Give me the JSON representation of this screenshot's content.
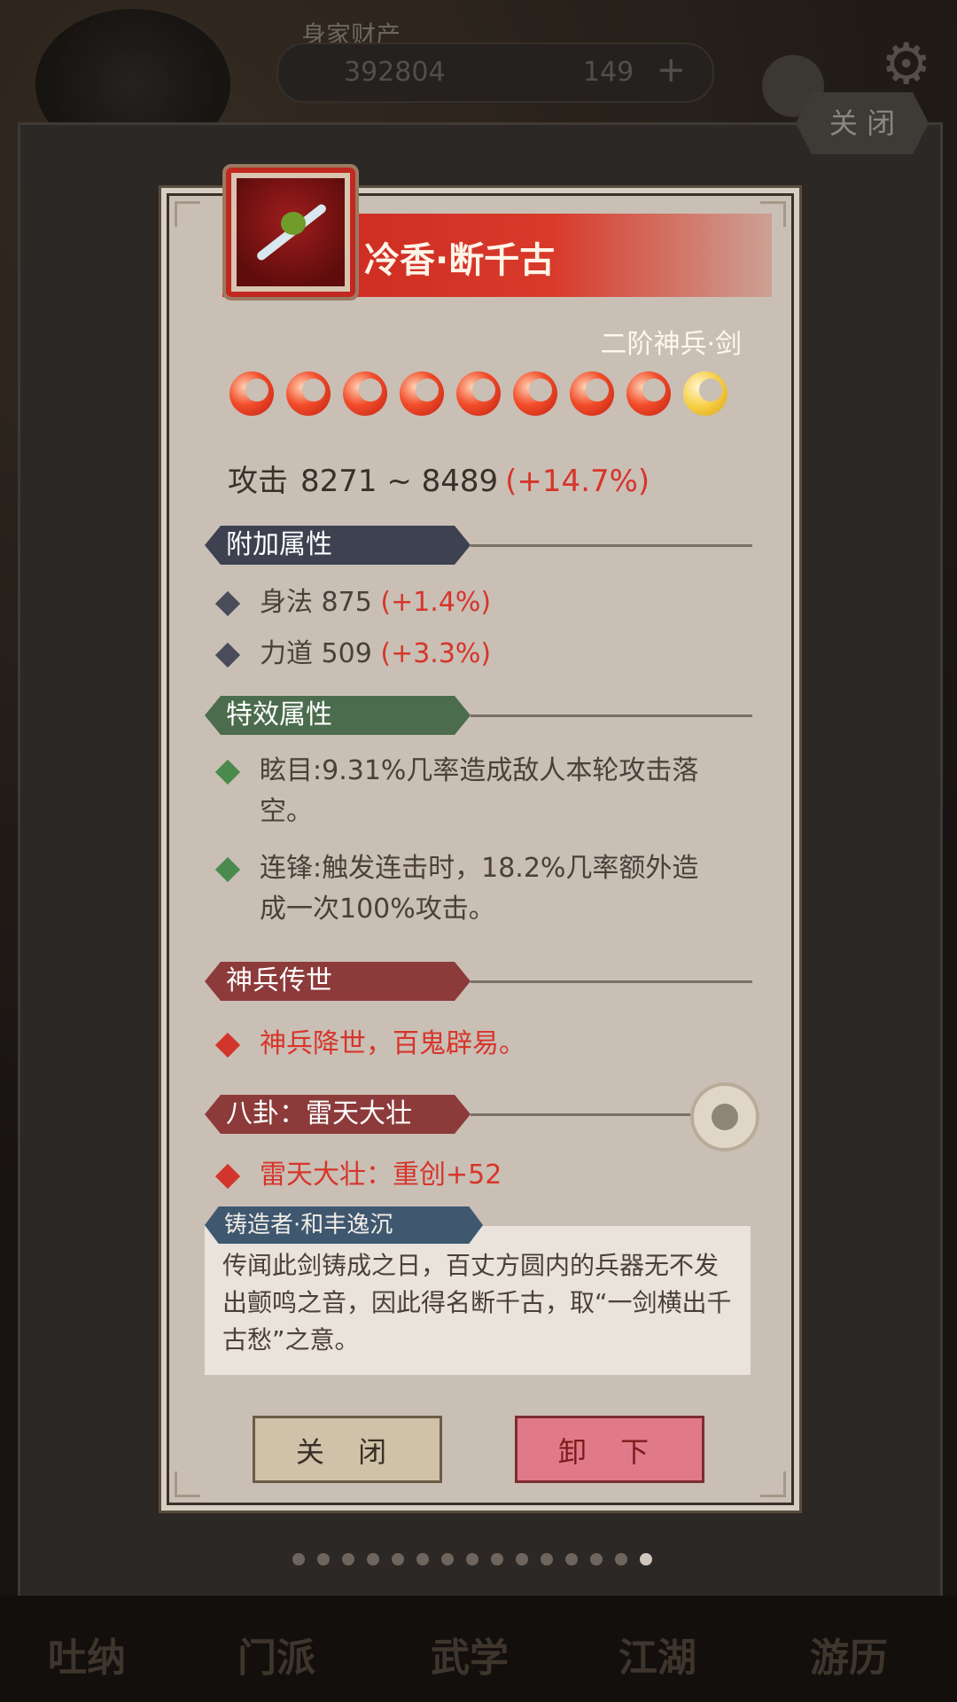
{
  "background": {
    "wealth_label": "身家财产",
    "silver_amount": "392804",
    "jade_amount": "149",
    "plus_symbol": "+",
    "close_top_label": "关 闭",
    "bottom_nav": [
      "吐纳",
      "门派",
      "武学",
      "江湖",
      "游历"
    ]
  },
  "dialog": {
    "title": "冷香·断千古",
    "grade": "二阶神兵·剑",
    "flames": {
      "red_count": 8,
      "gold_count": 1
    },
    "attack": {
      "label": "攻击",
      "range": "8271 ~ 8489",
      "bonus": "(+14.7%)"
    },
    "sections": {
      "extra": {
        "title": "附加属性",
        "items": [
          {
            "name": "身法",
            "value": "875",
            "bonus": "(+1.4%)"
          },
          {
            "name": "力道",
            "value": "509",
            "bonus": "(+3.3%)"
          }
        ]
      },
      "special": {
        "title": "特效属性",
        "items": [
          {
            "text": "眩目:9.31%几率造成敌人本轮攻击落空。"
          },
          {
            "text": "连锋:触发连击时，18.2%几率额外造成一次100%攻击。"
          }
        ]
      },
      "legend": {
        "title": "神兵传世",
        "items": [
          {
            "text": "神兵降世，百鬼辟易。"
          }
        ]
      },
      "bagua": {
        "title": "八卦：雷天大壮",
        "items": [
          {
            "text": "雷天大壮：重创+52"
          }
        ]
      }
    },
    "forger": "铸造者·和丰逸沉",
    "lore": "传闻此剑铸成之日，百丈方圆内的兵器无不发出颤鸣之音，因此得名断千古，取“一剑横出千古愁”之意。",
    "buttons": {
      "close": "关 闭",
      "unequip": "卸 下"
    }
  },
  "pager": {
    "count": 15,
    "active": 14
  },
  "colors": {
    "accent_red": "#d7352b",
    "title_red": "#c9261f"
  }
}
